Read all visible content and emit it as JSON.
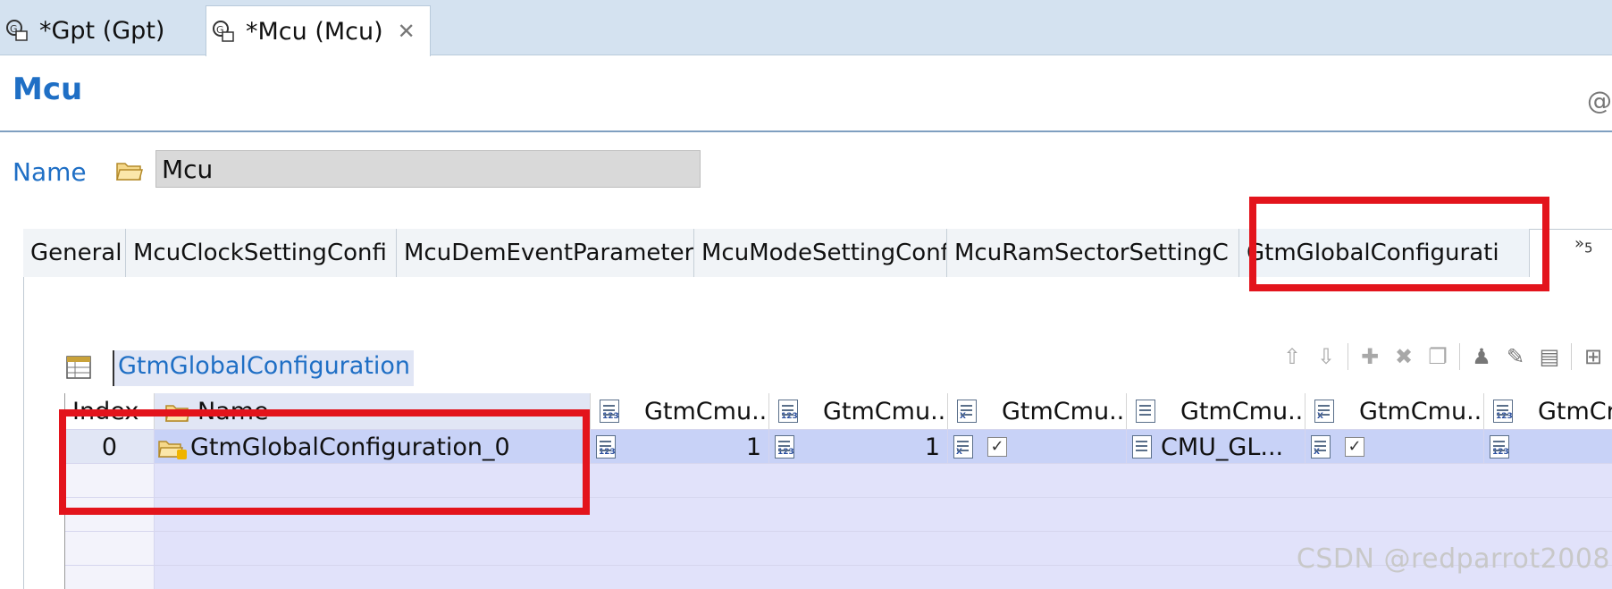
{
  "editor_tabs": [
    {
      "label": "*Gpt (Gpt)",
      "active": false
    },
    {
      "label": "*Mcu (Mcu)",
      "active": true
    }
  ],
  "page": {
    "title": "Mcu",
    "name_label": "Name",
    "name_value": "Mcu",
    "right_symbol": "@"
  },
  "section_tabs": [
    {
      "label": "General"
    },
    {
      "label": "McuClockSettingConfi"
    },
    {
      "label": "McuDemEventParameter"
    },
    {
      "label": "McuModeSettingConf"
    },
    {
      "label": "McuRamSectorSettingC"
    },
    {
      "label": "GtmGlobalConfigurati"
    }
  ],
  "overflow": {
    "chevron": "»",
    "count": "5"
  },
  "list": {
    "title": "GtmGlobalConfiguration",
    "columns": [
      {
        "label": "Index"
      },
      {
        "label": "Name"
      },
      {
        "label": "GtmCmu..."
      },
      {
        "label": "GtmCmu..."
      },
      {
        "label": "GtmCmu..."
      },
      {
        "label": "GtmCmu..."
      },
      {
        "label": "GtmCmu..."
      },
      {
        "label": "GtmCr"
      }
    ],
    "rows": [
      {
        "index": "0",
        "name": "GtmGlobalConfiguration_0",
        "c1": "1",
        "c2": "1",
        "c3": "✓",
        "c4": "CMU_GL...",
        "c5": "✓",
        "c6": ""
      }
    ]
  },
  "toolbar_icons": [
    "up-arrow-icon",
    "down-arrow-icon",
    "add-icon",
    "delete-icon",
    "copy-icon",
    "user-add-icon",
    "edit-icon",
    "table-edit-icon",
    "insert-icon"
  ],
  "watermark": "CSDN @redparrot2008",
  "colors": {
    "accent": "#1f6fc5",
    "highlight": "#e3141c",
    "selected_row": "#c8d2f7",
    "grid_fill": "#e1e2fa"
  }
}
